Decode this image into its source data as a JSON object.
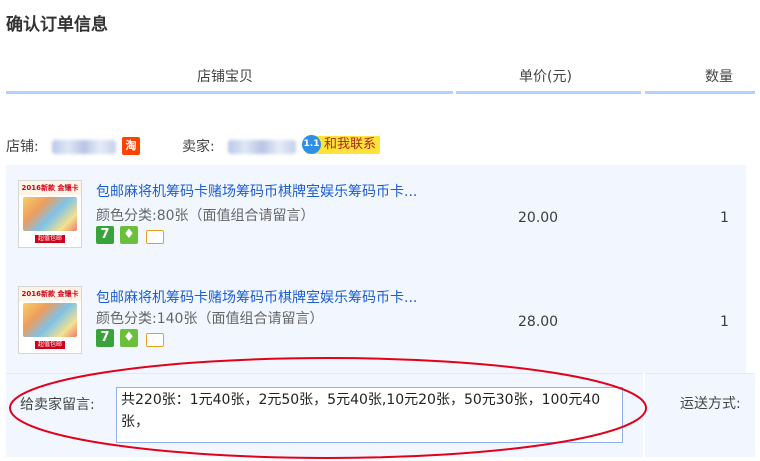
{
  "page": {
    "title": "确认订单信息"
  },
  "table_header": {
    "shop_items": "店铺宝贝",
    "unit_price": "单价(元)",
    "quantity": "数量"
  },
  "shop": {
    "shop_label": "店铺:",
    "seller_label": "卖家:",
    "taobao_icon_text": "淘",
    "chat_label": "和我联系",
    "chat_icon_text": "1.1"
  },
  "items": [
    {
      "thumb_top": "2016新款 金镶卡",
      "thumb_foot": "超值包邮",
      "title": "包邮麻将机筹码卡赌场筹码币棋牌室娱乐筹码币卡...",
      "sku_label": "颜色分类:",
      "sku_value": "80张（面值组合请留言）",
      "badge_7": "7",
      "price": "20.00",
      "qty": "1"
    },
    {
      "thumb_top": "2016新款 金镶卡",
      "thumb_foot": "超值包邮",
      "title": "包邮麻将机筹码卡赌场筹码币棋牌室娱乐筹码币卡...",
      "sku_label": "颜色分类:",
      "sku_value": "140张（面值组合请留言）",
      "badge_7": "7",
      "price": "28.00",
      "qty": "1"
    }
  ],
  "message": {
    "label": "给卖家留言:",
    "value": "共220张：1元40张，2元50张，5元40张,10元20张，50元30张，100元40张，"
  },
  "shipping": {
    "label": "运送方式:"
  },
  "colors": {
    "link": "#1d5fd1",
    "header_line": "#b2d1ff",
    "row_bg": "#f2f7ff",
    "annotation": "#e3001b"
  },
  "icons": [
    "taobao-icon",
    "chat-icon",
    "tmall-7-icon",
    "gold-seller-icon",
    "card-payment-icon"
  ]
}
